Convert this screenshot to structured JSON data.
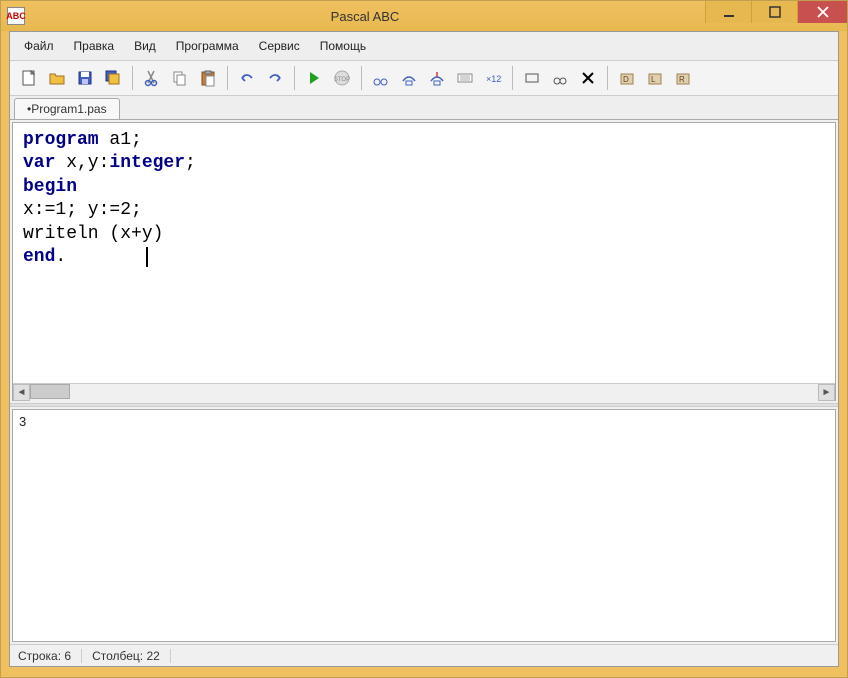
{
  "window": {
    "title": "Pascal ABC",
    "app_icon_text": "ABC"
  },
  "menu": {
    "items": [
      "Файл",
      "Правка",
      "Вид",
      "Программа",
      "Сервис",
      "Помощь"
    ]
  },
  "tabs": {
    "active": "•Program1.pas"
  },
  "code": {
    "line1_kw": "program",
    "line1_rest": " a1;",
    "line2_kw": "var",
    "line2_rest": " x,y:",
    "line2_ty": "integer",
    "line2_end": ";",
    "line3_kw": "begin",
    "line4": "x:=1; y:=2;",
    "line5": "writeln (x+y)",
    "line6_kw": "end",
    "line6_rest": "."
  },
  "output": {
    "text": "3"
  },
  "status": {
    "line_label": "Строка:",
    "line_val": "6",
    "col_label": "Столбец:",
    "col_val": "22"
  },
  "toolbar_icons": {
    "new": "new-file-icon",
    "open": "open-folder-icon",
    "save": "save-icon",
    "saveall": "save-all-icon",
    "cut": "cut-icon",
    "copy": "copy-icon",
    "paste": "paste-icon",
    "undo": "undo-icon",
    "redo": "redo-icon",
    "run": "run-icon",
    "stop": "stop-icon",
    "stepinto": "step-into-icon",
    "stepover": "step-over-icon",
    "stepout": "step-out-icon",
    "watch": "watch-icon",
    "eval": "eval-icon",
    "rect": "rect-icon",
    "view": "view-icon",
    "delete": "delete-icon",
    "d1": "debug1-icon",
    "d2": "debug2-icon",
    "d3": "debug3-icon"
  }
}
